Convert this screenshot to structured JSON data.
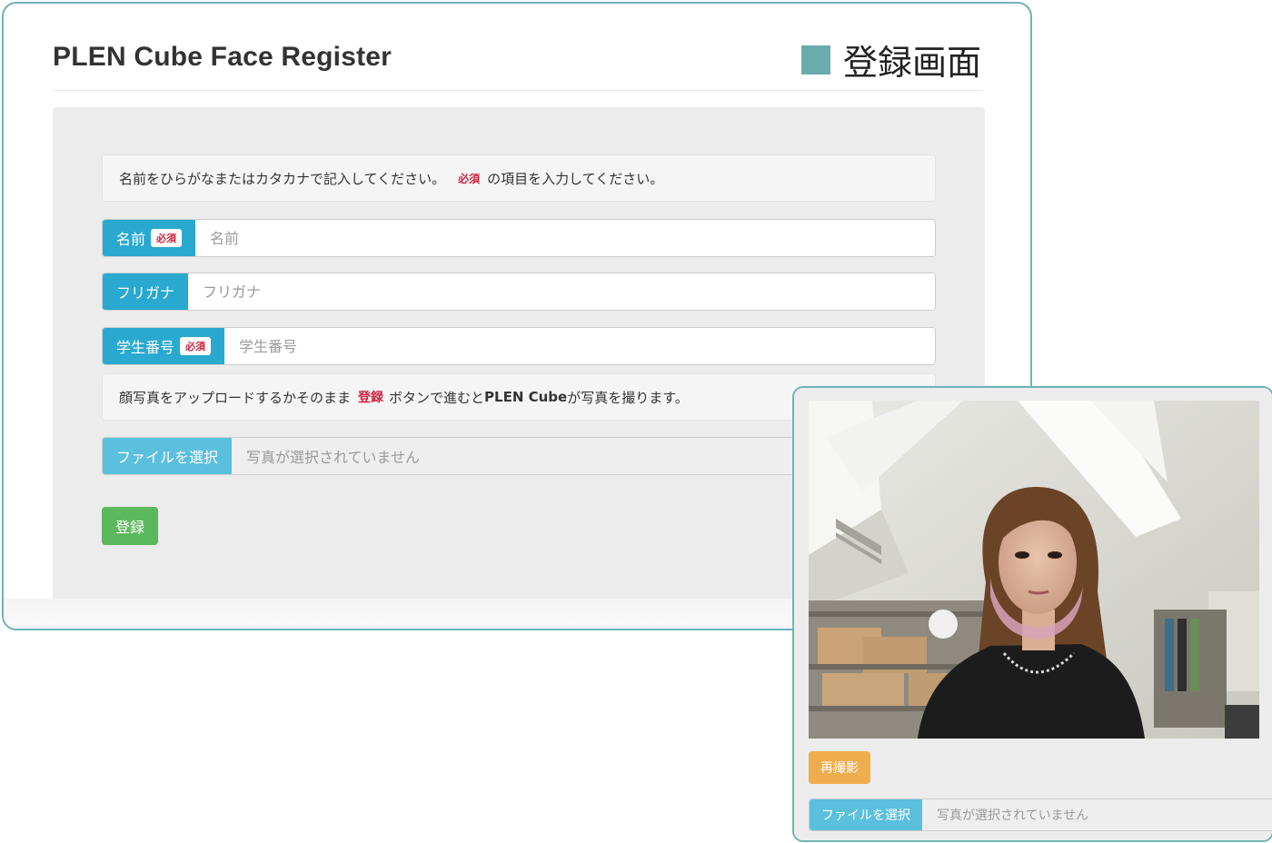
{
  "header": {
    "title": "PLEN Cube Face Register",
    "screen_label": "登録画面"
  },
  "form": {
    "intro_text_before": "名前をひらがなまたはカタカナで記入してください。",
    "intro_required_tag": "必須",
    "intro_text_after": "の項目を入力してください。",
    "name": {
      "label": "名前",
      "badge": "必須",
      "placeholder": "名前",
      "value": ""
    },
    "furigana": {
      "label": "フリガナ",
      "placeholder": "フリガナ",
      "value": ""
    },
    "student_number": {
      "label": "学生番号",
      "badge": "必須",
      "placeholder": "学生番号",
      "value": ""
    },
    "photo_note_before": "顔写真をアップロードするかそのまま",
    "photo_note_button_ref": "登録",
    "photo_note_middle": "ボタンで進むと",
    "photo_note_bold": "PLEN Cube",
    "photo_note_after": "が写真を撮ります。",
    "file_button_label": "ファイルを選択",
    "file_status": "写真が選択されていません",
    "submit_label": "登録"
  },
  "camera": {
    "retake_label": "再撮影",
    "file_button_label": "ファイルを選択",
    "file_status": "写真が選択されていません"
  },
  "colors": {
    "accent_teal": "#6fb3b5",
    "addon_blue": "#29a9d0",
    "submit_green": "#5cb85c",
    "retake_orange": "#f0ad4e",
    "required_red": "#d0233f"
  }
}
